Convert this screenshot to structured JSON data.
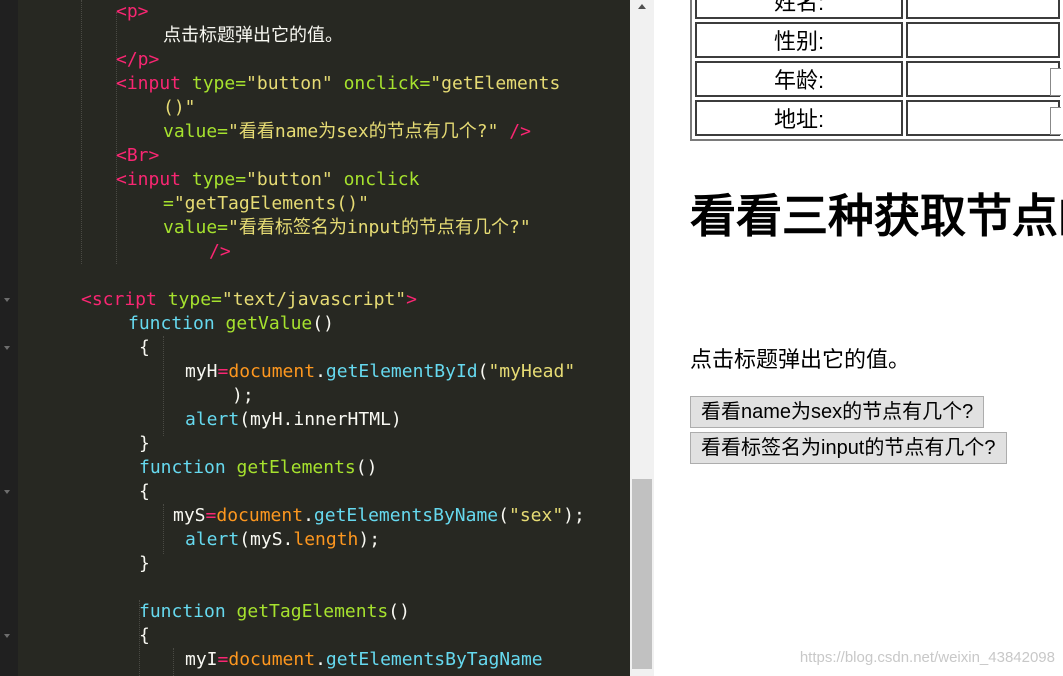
{
  "editor": {
    "lines": [
      {
        "indent": 98,
        "tokens": [
          [
            "tag",
            "<p>"
          ]
        ]
      },
      {
        "indent": 145,
        "tokens": [
          [
            "txt",
            "点击标题弹出它的值。"
          ]
        ]
      },
      {
        "indent": 98,
        "tokens": [
          [
            "tag",
            "</p>"
          ]
        ]
      },
      {
        "indent": 98,
        "tokens": [
          [
            "tag",
            "<input "
          ],
          [
            "attr",
            "type="
          ],
          [
            "str",
            "\"button\""
          ],
          [
            "txt",
            " "
          ],
          [
            "attr",
            "onclick="
          ],
          [
            "str",
            "\"getElements"
          ]
        ]
      },
      {
        "indent": 145,
        "tokens": [
          [
            "str",
            "()\""
          ]
        ]
      },
      {
        "indent": 145,
        "tokens": [
          [
            "attr",
            "value="
          ],
          [
            "str",
            "\"看看name为sex的节点有几个?\""
          ],
          [
            "txt",
            " "
          ],
          [
            "tag",
            "/>"
          ]
        ]
      },
      {
        "indent": 98,
        "tokens": [
          [
            "tag",
            "<Br>"
          ]
        ]
      },
      {
        "indent": 98,
        "tokens": [
          [
            "tag",
            "<input "
          ],
          [
            "attr",
            "type="
          ],
          [
            "str",
            "\"button\""
          ],
          [
            "txt",
            " "
          ],
          [
            "attr",
            "onclick"
          ]
        ]
      },
      {
        "indent": 145,
        "tokens": [
          [
            "attr",
            "="
          ],
          [
            "str",
            "\"getTagElements()\""
          ]
        ]
      },
      {
        "indent": 145,
        "tokens": [
          [
            "attr",
            "value="
          ],
          [
            "str",
            "\"看看标签名为input的节点有几个?\""
          ]
        ]
      },
      {
        "indent": 191,
        "tokens": [
          [
            "tag",
            "/>"
          ]
        ]
      },
      {
        "indent": 0,
        "tokens": []
      },
      {
        "indent": 63,
        "tokens": [
          [
            "tag",
            "<script "
          ],
          [
            "attr",
            "type="
          ],
          [
            "str",
            "\"text/javascript\""
          ],
          [
            "tag",
            ">"
          ]
        ]
      },
      {
        "indent": 110,
        "tokens": [
          [
            "kw",
            "function "
          ],
          [
            "fn",
            "getValue"
          ],
          [
            "txt",
            "()"
          ]
        ]
      },
      {
        "indent": 121,
        "tokens": [
          [
            "txt",
            "{"
          ]
        ]
      },
      {
        "indent": 167,
        "tokens": [
          [
            "txt",
            "myH"
          ],
          [
            "op",
            "="
          ],
          [
            "obj",
            "document"
          ],
          [
            "txt",
            "."
          ],
          [
            "prop",
            "getElementById"
          ],
          [
            "txt",
            "("
          ],
          [
            "str",
            "\"myHead\""
          ]
        ]
      },
      {
        "indent": 214,
        "tokens": [
          [
            "txt",
            ");"
          ]
        ]
      },
      {
        "indent": 167,
        "tokens": [
          [
            "prop",
            "alert"
          ],
          [
            "txt",
            "(myH.innerHTML)"
          ]
        ]
      },
      {
        "indent": 121,
        "tokens": [
          [
            "txt",
            "}"
          ]
        ]
      },
      {
        "indent": 121,
        "tokens": [
          [
            "kw",
            "function "
          ],
          [
            "fn",
            "getElements"
          ],
          [
            "txt",
            "()"
          ]
        ]
      },
      {
        "indent": 121,
        "tokens": [
          [
            "txt",
            "{"
          ]
        ]
      },
      {
        "indent": 155,
        "tokens": [
          [
            "txt",
            "myS"
          ],
          [
            "op",
            "="
          ],
          [
            "obj",
            "document"
          ],
          [
            "txt",
            "."
          ],
          [
            "prop",
            "getElementsByName"
          ],
          [
            "txt",
            "("
          ],
          [
            "str",
            "\"sex\""
          ],
          [
            "txt",
            ");"
          ]
        ]
      },
      {
        "indent": 167,
        "tokens": [
          [
            "prop",
            "alert"
          ],
          [
            "txt",
            "(myS."
          ],
          [
            "obj",
            "length"
          ],
          [
            "txt",
            ");"
          ]
        ]
      },
      {
        "indent": 121,
        "tokens": [
          [
            "txt",
            "}"
          ]
        ]
      },
      {
        "indent": 0,
        "tokens": []
      },
      {
        "indent": 121,
        "tokens": [
          [
            "kw",
            "function "
          ],
          [
            "fn",
            "getTagElements"
          ],
          [
            "txt",
            "()"
          ]
        ]
      },
      {
        "indent": 121,
        "tokens": [
          [
            "txt",
            "{"
          ]
        ]
      },
      {
        "indent": 167,
        "tokens": [
          [
            "txt",
            "myI"
          ],
          [
            "op",
            "="
          ],
          [
            "obj",
            "document"
          ],
          [
            "txt",
            "."
          ],
          [
            "prop",
            "getElementsByTagName"
          ]
        ]
      }
    ],
    "colors": {
      "background": "#272822",
      "tag": "#f92672",
      "attribute": "#a6e22e",
      "string": "#e6db74",
      "keyword": "#66d9ef",
      "object": "#fd971f"
    }
  },
  "preview": {
    "form_rows": [
      {
        "label": "姓名:"
      },
      {
        "label": "性别:"
      },
      {
        "label": "年龄:"
      },
      {
        "label": "地址:"
      }
    ],
    "heading": "看看三种获取节点的方法?",
    "intro": "点击标题弹出它的值。",
    "button_sex": "看看name为sex的节点有几个?",
    "button_input": "看看标签名为input的节点有几个?",
    "watermark": "https://blog.csdn.net/weixin_43842098"
  }
}
